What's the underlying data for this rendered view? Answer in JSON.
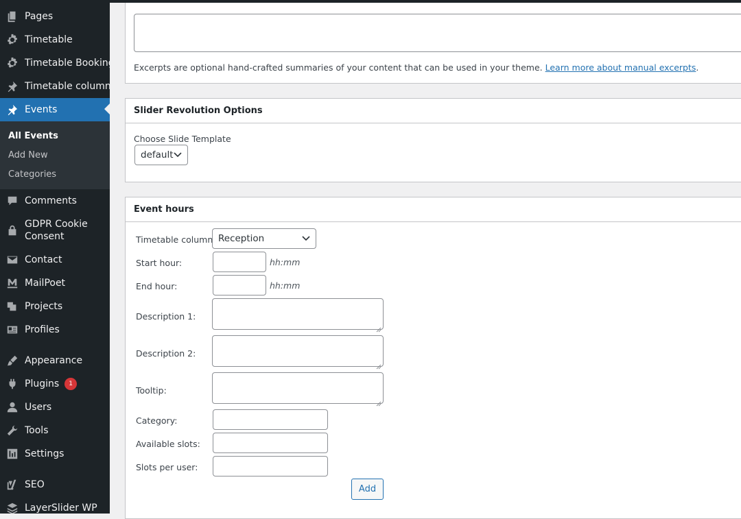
{
  "sidebar": {
    "items": [
      {
        "label": "Pages",
        "icon": "pages-icon"
      },
      {
        "label": "Timetable",
        "icon": "gear-icon"
      },
      {
        "label": "Timetable Bookings",
        "icon": "gear-icon"
      },
      {
        "label": "Timetable columns",
        "icon": "pin-icon"
      },
      {
        "label": "Events",
        "icon": "pin-icon"
      },
      {
        "label": "Comments",
        "icon": "comment-icon"
      },
      {
        "label": "GDPR Cookie Consent",
        "icon": "lock-icon"
      },
      {
        "label": "Contact",
        "icon": "mail-icon"
      },
      {
        "label": "MailPoet",
        "icon": "mailpoet-icon"
      },
      {
        "label": "Projects",
        "icon": "projects-icon"
      },
      {
        "label": "Profiles",
        "icon": "id-card-icon"
      },
      {
        "label": "Appearance",
        "icon": "brush-icon"
      },
      {
        "label": "Plugins",
        "icon": "plug-icon",
        "badge": "1"
      },
      {
        "label": "Users",
        "icon": "user-icon"
      },
      {
        "label": "Tools",
        "icon": "wrench-icon"
      },
      {
        "label": "Settings",
        "icon": "settings-icon"
      },
      {
        "label": "SEO",
        "icon": "yoast-icon"
      },
      {
        "label": "LayerSlider WP",
        "icon": "layers-icon"
      }
    ],
    "submenu": [
      "All Events",
      "Add New",
      "Categories"
    ],
    "colors": {
      "background": "#1d2327",
      "active": "#2271b1",
      "submenu_bg": "#2c3338",
      "badge": "#d63638"
    }
  },
  "excerpt": {
    "help_text": "Excerpts are optional hand-crafted summaries of your content that can be used in your theme.",
    "help_link": "Learn more about manual excerpts",
    "help_end": "."
  },
  "slider_revolution": {
    "title": "Slider Revolution Options",
    "choose_label": "Choose Slide Template",
    "selected": "default"
  },
  "event_hours": {
    "title": "Event hours",
    "timetable_column_label": "Timetable column:",
    "timetable_column_value": "Reception",
    "start_hour_label": "Start hour:",
    "end_hour_label": "End hour:",
    "time_hint": "hh:mm",
    "description1_label": "Description 1:",
    "description2_label": "Description 2:",
    "tooltip_label": "Tooltip:",
    "category_label": "Category:",
    "available_slots_label": "Available slots:",
    "slots_per_user_label": "Slots per user:",
    "add_button": "Add"
  }
}
